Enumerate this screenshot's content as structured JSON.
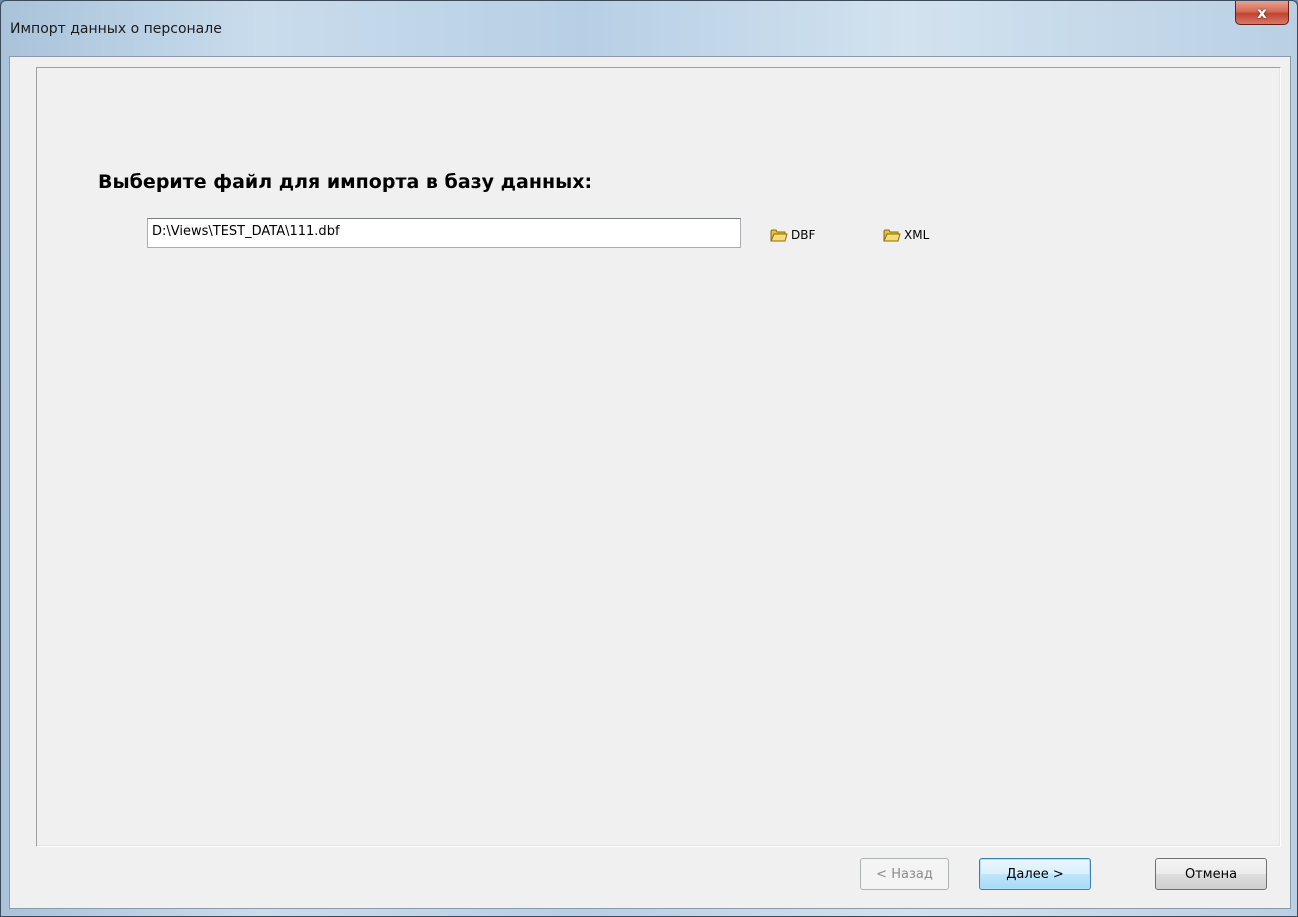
{
  "window": {
    "title": "Импорт данных о персонале",
    "close_label": "x"
  },
  "main": {
    "heading": "Выберите файл для импорта в базу данных:",
    "file_path": "D:\\Views\\TEST_DATA\\111.dbf",
    "dbf_label": "DBF",
    "xml_label": "XML"
  },
  "footer": {
    "back_label": "< Назад",
    "next_label": "Далее >",
    "cancel_label": "Отмена"
  },
  "colors": {
    "folder": "#f2d35a",
    "default_button_border": "#3c7fb1"
  }
}
